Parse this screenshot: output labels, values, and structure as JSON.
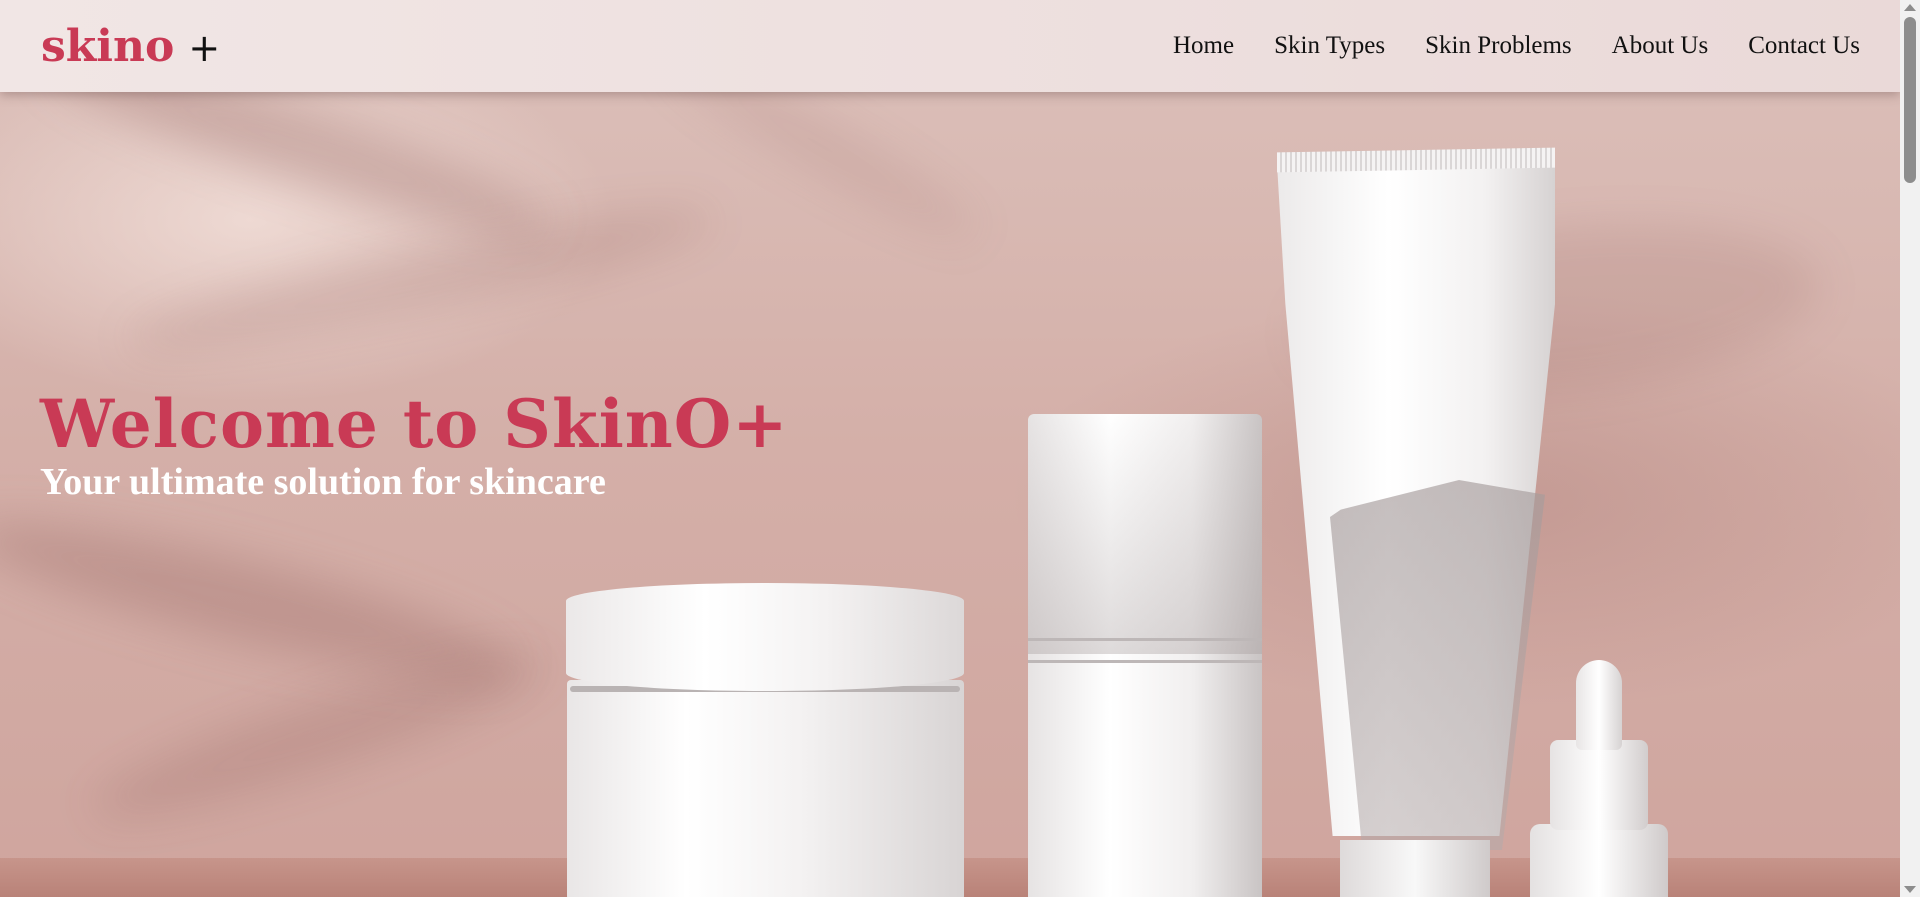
{
  "header": {
    "brand_name": "skino",
    "brand_plus": "+",
    "nav": [
      {
        "label": "Home"
      },
      {
        "label": "Skin Types"
      },
      {
        "label": "Skin Problems"
      },
      {
        "label": "About Us"
      },
      {
        "label": "Contact Us"
      }
    ]
  },
  "hero": {
    "title": "Welcome to SkinO+",
    "subtitle": "Your ultimate solution for skincare"
  },
  "colors": {
    "brand": "#c93a55",
    "header_bg": "#efe3e2",
    "hero_bg": "#d4afa8"
  },
  "icons": [
    "scroll-up-arrow-icon",
    "scroll-down-arrow-icon"
  ]
}
